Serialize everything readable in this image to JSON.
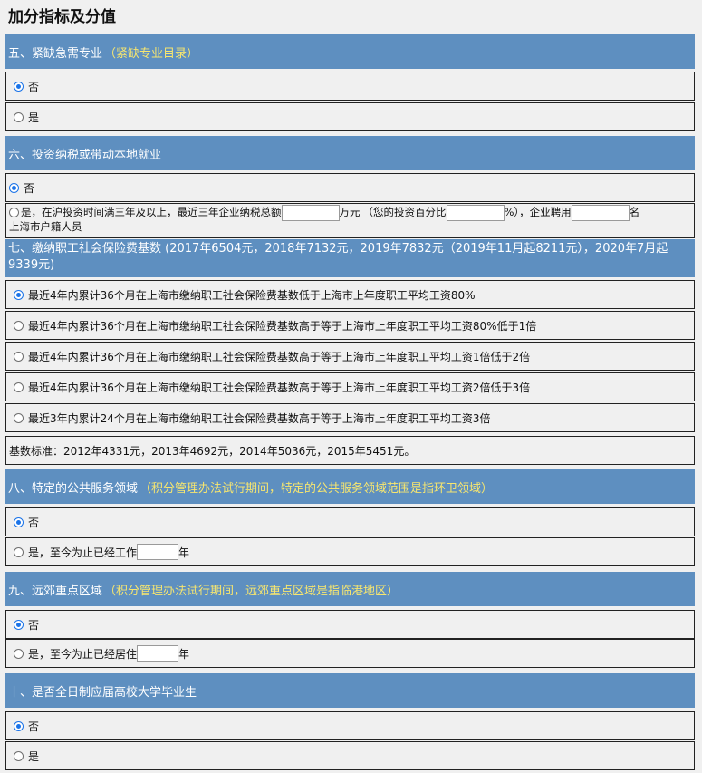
{
  "page_title": "加分指标及分值",
  "sections": {
    "s5": {
      "title": "五、紧缺急需专业",
      "note": "（紧缺专业目录）",
      "opt_no": "否",
      "opt_yes": "是"
    },
    "s6": {
      "title": "六、投资纳税或带动本地就业",
      "opt_no": "否",
      "opt_yes_a": "是，在沪投资时间满三年及以上，最近三年企业纳税总额",
      "unit_wan": "万元",
      "invest_pct": "（您的投资百分比",
      "pct_close": "%），企业聘用",
      "ming": "名",
      "line2": "上海市户籍人员"
    },
    "s7": {
      "title": "七、缴纳职工社会保险费基数 (2017年6504元，2018年7132元，2019年7832元（2019年11月起8211元），2020年7月起9339元)",
      "opts": [
        "最近4年内累计36个月在上海市缴纳职工社会保险费基数低于上海市上年度职工平均工资80%",
        "最近4年内累计36个月在上海市缴纳职工社会保险费基数高于等于上海市上年度职工平均工资80%低于1倍",
        "最近4年内累计36个月在上海市缴纳职工社会保险费基数高于等于上海市上年度职工平均工资1倍低于2倍",
        "最近4年内累计36个月在上海市缴纳职工社会保险费基数高于等于上海市上年度职工平均工资2倍低于3倍",
        "最近3年内累计24个月在上海市缴纳职工社会保险费基数高于等于上海市上年度职工平均工资3倍"
      ],
      "base_note": "基数标准：2012年4331元，2013年4692元，2014年5036元，2015年5451元。"
    },
    "s8": {
      "title": "八、特定的公共服务领域",
      "note": "（积分管理办法试行期间，特定的公共服务领域范围是指环卫领域）",
      "opt_no": "否",
      "opt_yes": "是，至今为止已经工作",
      "unit": "年"
    },
    "s9": {
      "title": "九、远郊重点区域",
      "note": "（积分管理办法试行期间，远郊重点区域是指临港地区）",
      "opt_no": "否",
      "opt_yes": "是，至今为止已经居住",
      "unit": "年"
    },
    "s10": {
      "title": "十、是否全日制应届高校大学毕业生",
      "opt_no": "否",
      "opt_yes": "是"
    }
  },
  "colors": {
    "header_bg": "#5e8fc0",
    "header_note": "#f7e66f",
    "page_bg": "#f0f0f0"
  }
}
